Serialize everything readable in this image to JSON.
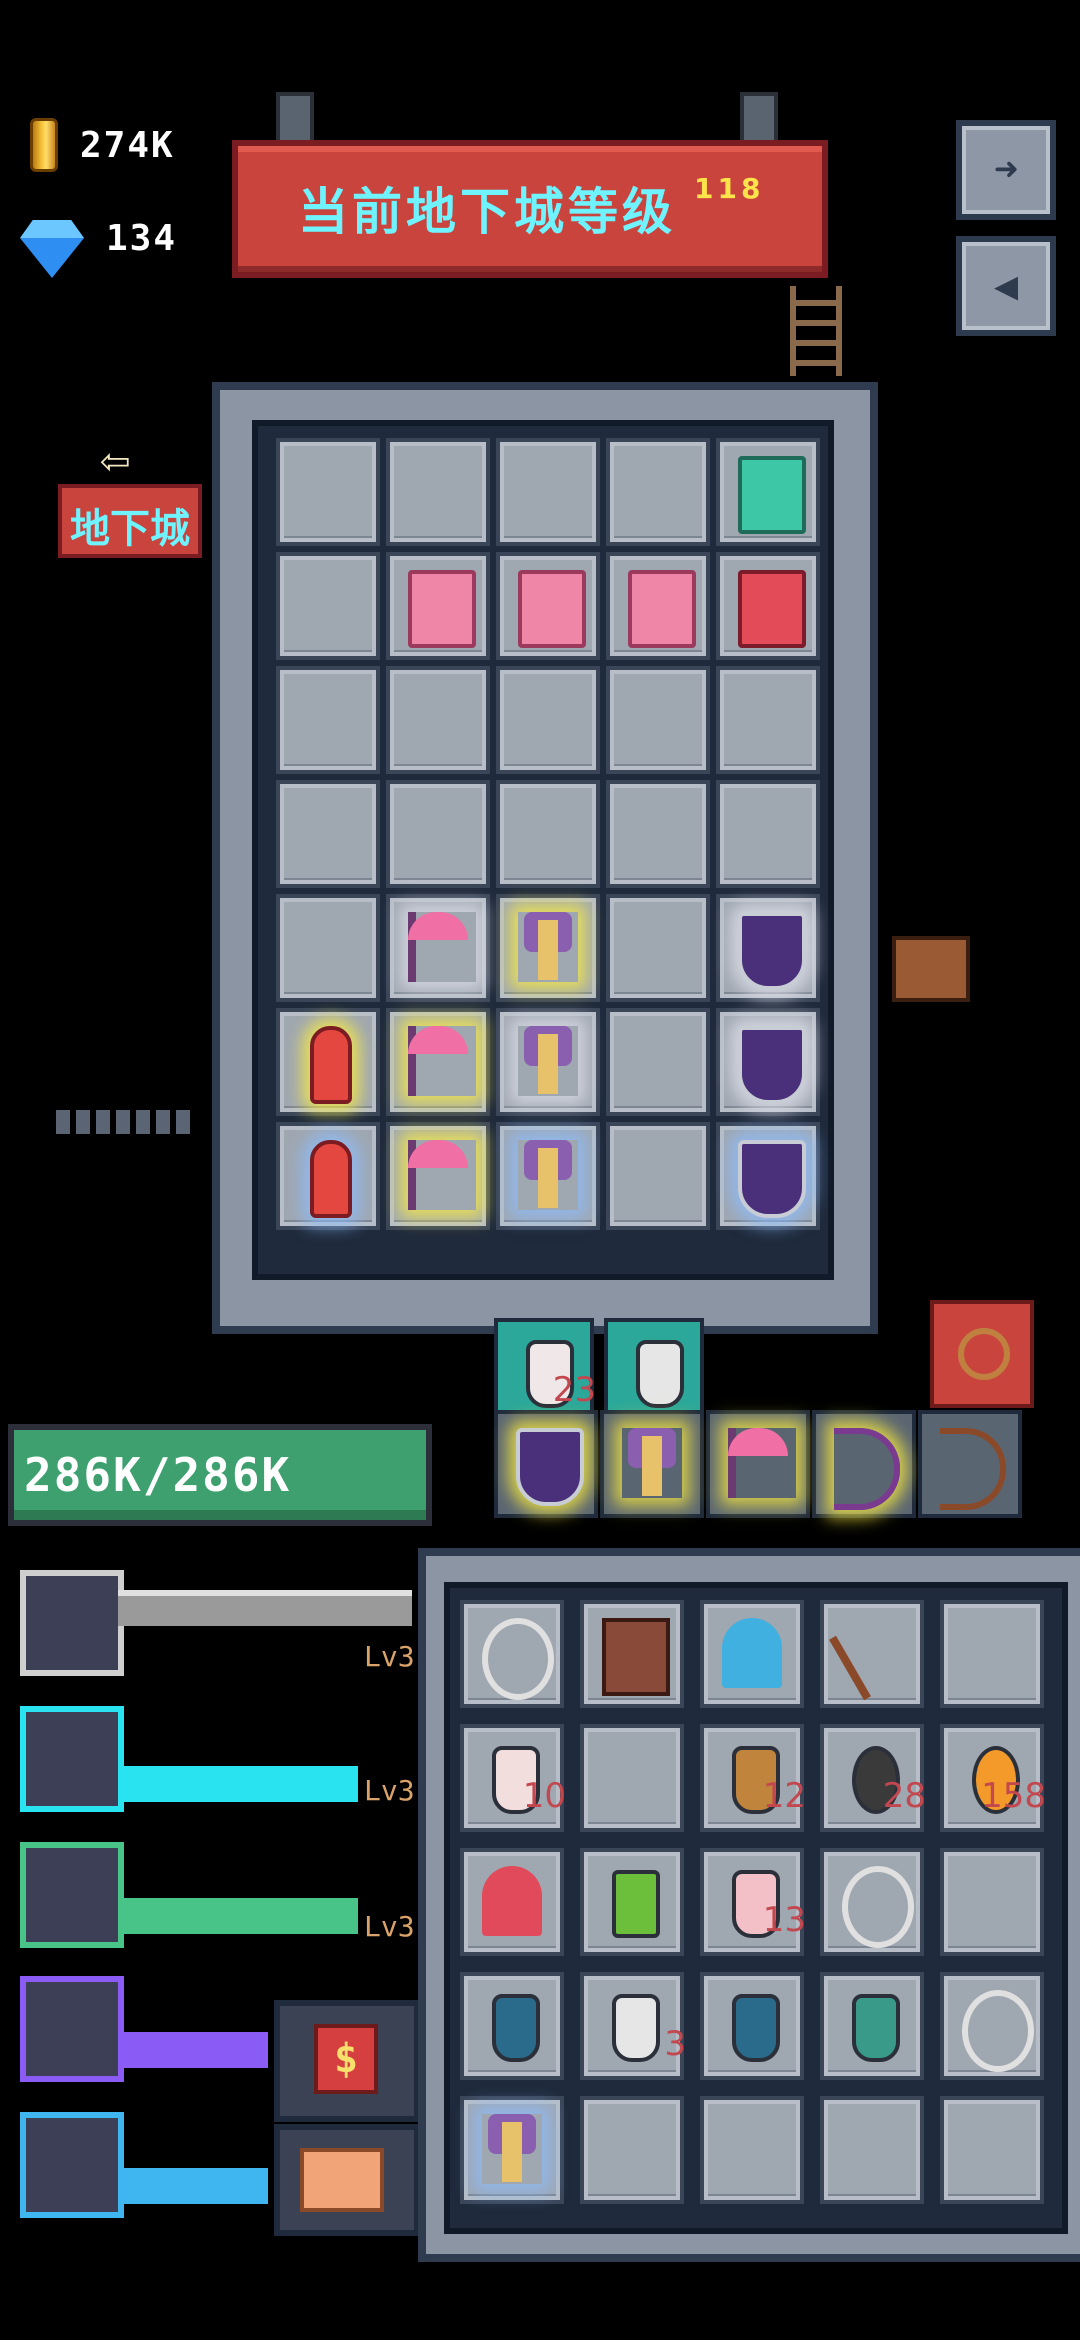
{
  "currency": {
    "gold": "274K",
    "gems": "134"
  },
  "banner": {
    "title": "当前地下城等级",
    "level": "118"
  },
  "nav": {
    "back_label": "地下城"
  },
  "hp": {
    "text": "286K/286K"
  },
  "skills": [
    {
      "name": "skill-1",
      "level": "Lv3",
      "color": "#d9d9d9"
    },
    {
      "name": "skill-2",
      "level": "Lv3",
      "color": "#29e3f0"
    },
    {
      "name": "skill-3",
      "level": "Lv3",
      "color": "#48c489"
    },
    {
      "name": "skill-4",
      "level": "",
      "color": "#8a5cf5"
    },
    {
      "name": "skill-5",
      "level": "",
      "color": "#3fb6f0"
    }
  ],
  "potion_bar": {
    "red_potion_count": "23"
  },
  "inventory_counts": {
    "red_potion": "10",
    "gourd": "12",
    "stone": "28",
    "orb": "158",
    "pink_potion": "13",
    "white_potion": "3"
  }
}
